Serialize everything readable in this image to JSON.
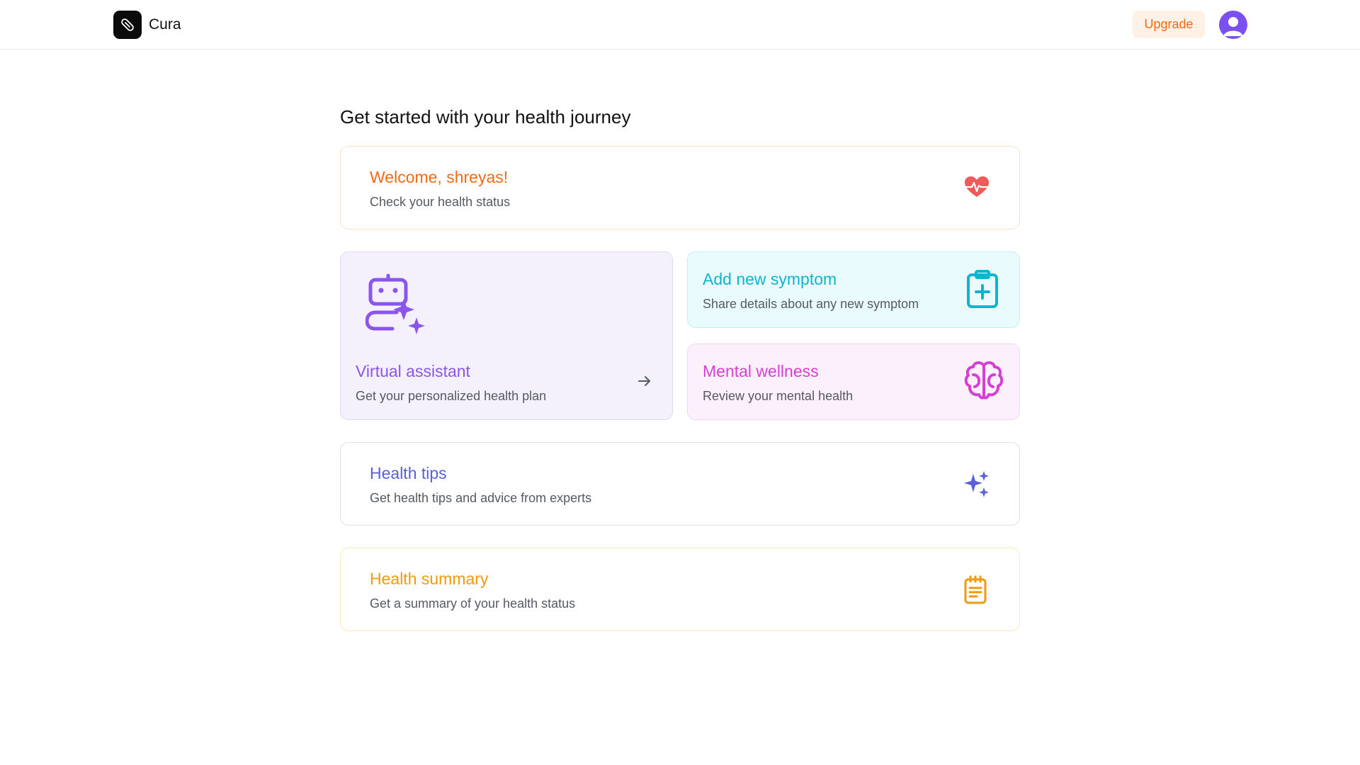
{
  "header": {
    "brand_name": "Cura",
    "upgrade_label": "Upgrade",
    "logo_icon": "pill-icon",
    "avatar_icon": "user-avatar-icon"
  },
  "main": {
    "title": "Get started with your health journey",
    "cards": {
      "welcome": {
        "title": "Welcome, shreyas!",
        "subtitle": "Check your health status",
        "icon": "heart-pulse-icon",
        "color": "#f26b12"
      },
      "assistant": {
        "title": "Virtual assistant",
        "subtitle": "Get your personalized health plan",
        "icon": "robot-sparkle-icon",
        "color": "#8a55ea"
      },
      "symptom": {
        "title": "Add new symptom",
        "subtitle": "Share details about any new symptom",
        "icon": "clipboard-plus-icon",
        "color": "#0fb4d0"
      },
      "mental": {
        "title": "Mental wellness",
        "subtitle": "Review your mental health",
        "icon": "brain-icon",
        "color": "#d63fd3"
      },
      "tips": {
        "title": "Health tips",
        "subtitle": "Get health tips and advice from experts",
        "icon": "sparkles-icon",
        "color": "#5a5fdc"
      },
      "summary": {
        "title": "Health summary",
        "subtitle": "Get a summary of your health status",
        "icon": "notepad-icon",
        "color": "#f29a0e"
      }
    }
  },
  "colors": {
    "accent_orange": "#f26b12",
    "upgrade_bg": "#fff1e6",
    "avatar_bg": "#7c4ff0"
  }
}
